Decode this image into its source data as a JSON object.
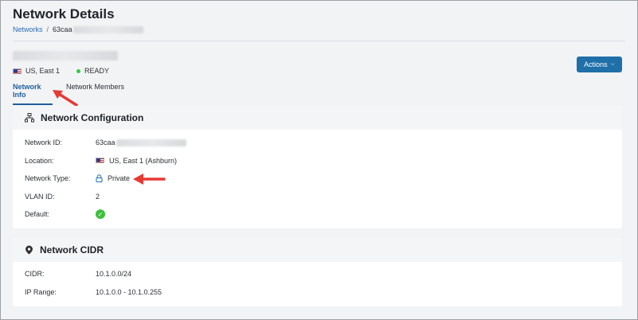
{
  "page": {
    "title": "Network Details"
  },
  "breadcrumb": {
    "root_label": "Networks",
    "separator": "/",
    "current_prefix": "63caa"
  },
  "header": {
    "region": "US, East 1",
    "status": "READY",
    "status_color": "#2ecc40",
    "actions_label": "Actions"
  },
  "tabs": [
    {
      "label": "Network Info",
      "active": true
    },
    {
      "label": "Network Members",
      "active": false
    }
  ],
  "network_configuration": {
    "title": "Network Configuration",
    "icon": "network-topology-icon",
    "rows": [
      {
        "label": "Network ID:",
        "value": "63caa"
      },
      {
        "label": "Location:",
        "value": "US, East 1 (Ashburn)"
      },
      {
        "label": "Network Type:",
        "value": "Private"
      },
      {
        "label": "VLAN ID:",
        "value": "2"
      },
      {
        "label": "Default:",
        "value": ""
      }
    ]
  },
  "network_cidr": {
    "title": "Network CIDR",
    "icon": "location-pin-icon",
    "rows": [
      {
        "label": "CIDR:",
        "value": "10.1.0.0/24"
      },
      {
        "label": "IP Range:",
        "value": "10.1.0.0 - 10.1.0.255"
      }
    ]
  },
  "colors": {
    "accent": "#1f6fa8",
    "link": "#2b6cb0",
    "annotation_arrow": "#e53935",
    "success": "#3fbf3f"
  }
}
